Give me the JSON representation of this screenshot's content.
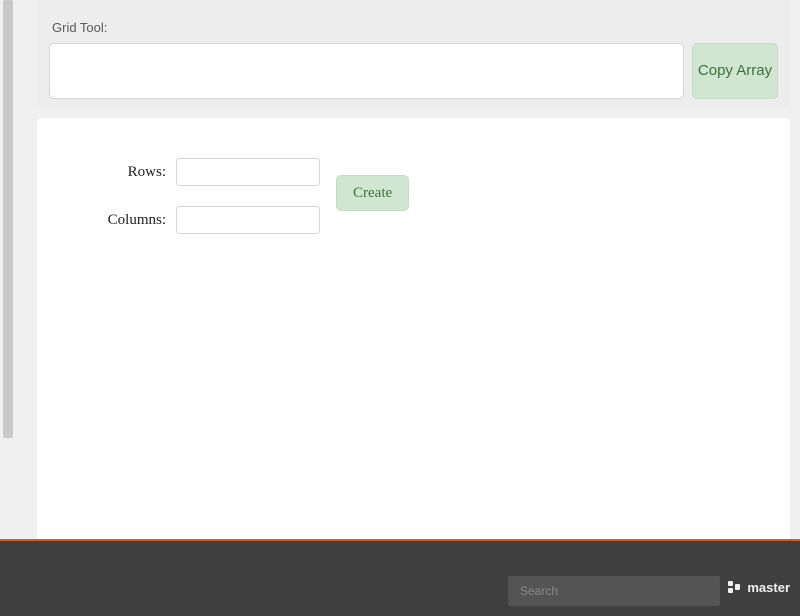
{
  "section": {
    "title": "Grid Tool:"
  },
  "toolbar": {
    "array_value": "",
    "copy_label": "Copy Array"
  },
  "form": {
    "rows_label": "Rows:",
    "columns_label": "Columns:",
    "rows_value": "",
    "columns_value": "",
    "create_label": "Create"
  },
  "footer": {
    "search_placeholder": "Search",
    "branch_label": "master"
  }
}
